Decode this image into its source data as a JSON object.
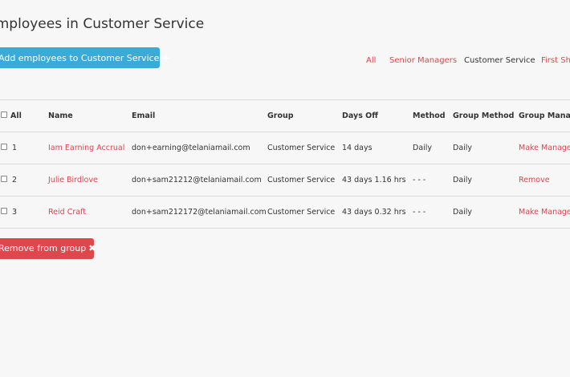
{
  "page": {
    "title": "Employees in Customer Service",
    "add_button_label": "Add employees to Customer Service",
    "add_button_icon": "+",
    "remove_button_label": "Remove from group",
    "remove_button_icon": "✖"
  },
  "filters": [
    {
      "label": "All",
      "active": false
    },
    {
      "label": "Senior Managers",
      "active": false
    },
    {
      "label": "Customer Service",
      "active": true
    },
    {
      "label": "First Shift",
      "active": false
    }
  ],
  "table": {
    "headers": {
      "select_all": "All",
      "name": "Name",
      "email": "Email",
      "group": "Group",
      "days_off": "Days Off",
      "method": "Method",
      "group_method": "Group Method",
      "group_manager": "Group Manager"
    },
    "rows": [
      {
        "num": "1",
        "name": "Iam Earning Accrual",
        "email": "don+earning@telaniamail.com",
        "group": "Customer Service",
        "days_off": "14 days",
        "method": "Daily",
        "group_method": "Daily",
        "action": "Make Manager"
      },
      {
        "num": "2",
        "name": "Julie Birdlove",
        "email": "don+sam21212@telaniamail.com",
        "group": "Customer Service",
        "days_off": "43 days 1.16 hrs",
        "method": "- - -",
        "group_method": "Daily",
        "action": "Remove"
      },
      {
        "num": "3",
        "name": "Reid Craft",
        "email": "don+sam212172@telaniamail.com",
        "group": "Customer Service",
        "days_off": "43 days 0.32 hrs",
        "method": "- - -",
        "group_method": "Daily",
        "action": "Make Manager"
      }
    ]
  },
  "colors": {
    "accent_blue": "#3aaad8",
    "danger_red": "#e0474c",
    "link_red": "#e0444b",
    "background": "#f7f7f7"
  }
}
